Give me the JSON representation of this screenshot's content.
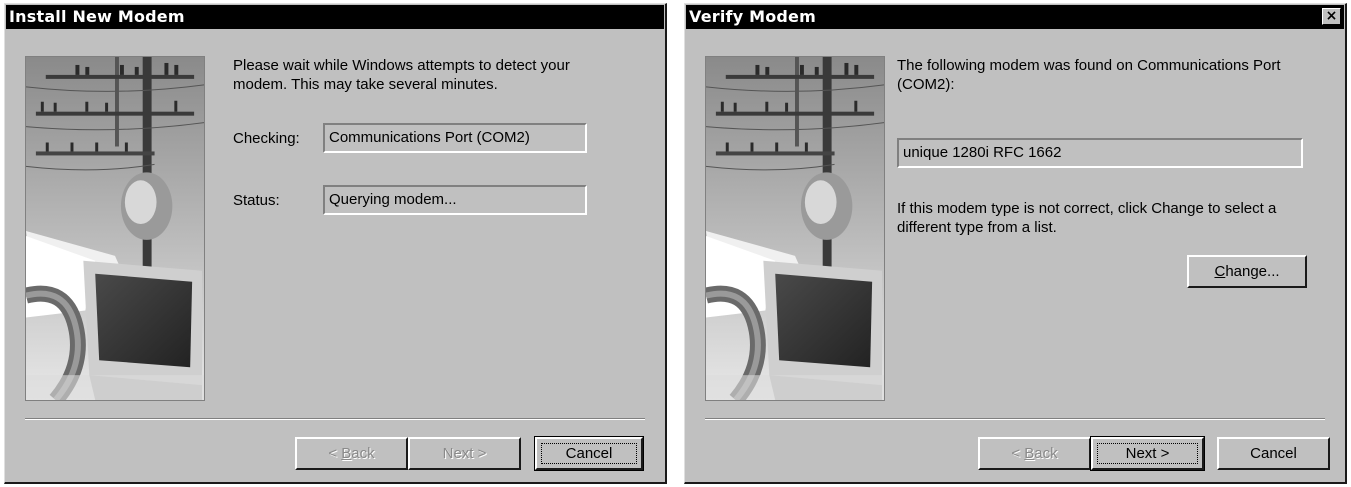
{
  "dialog1": {
    "title": "Install New Modem",
    "message": "Please wait while Windows attempts to detect your modem.  This may take several minutes.",
    "checking_label": "Checking:",
    "checking_value": "Communications Port (COM2)",
    "status_label": "Status:",
    "status_value": "Querying modem...",
    "buttons": {
      "back_prefix": "< ",
      "back_ul": "B",
      "back_rest": "ack",
      "next": "Next >",
      "cancel": "Cancel"
    }
  },
  "dialog2": {
    "title": "Verify Modem",
    "close_glyph": "×",
    "message": "The following modem was found on Communications Port (COM2):",
    "modem_value": "unique 1280i RFC 1662",
    "hint": "If this modem type is not correct, click Change to select a different type from a list.",
    "buttons": {
      "change_ul": "C",
      "change_rest": "hange...",
      "back_prefix": "< ",
      "back_ul": "B",
      "back_rest": "ack",
      "next": "Next >",
      "cancel": "Cancel"
    }
  }
}
